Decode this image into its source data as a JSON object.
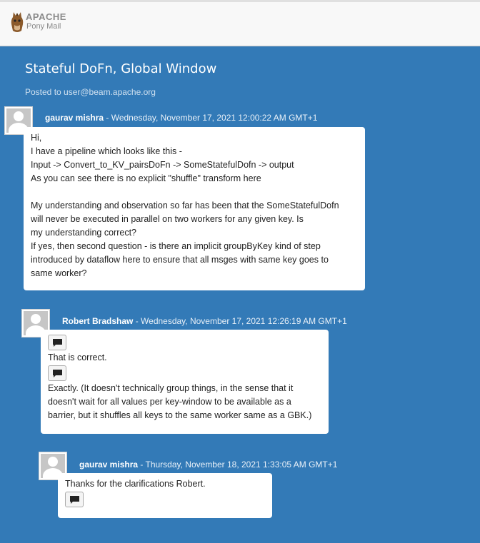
{
  "header": {
    "logo_line1": "APACHE",
    "logo_line2": "Pony Mail"
  },
  "thread": {
    "title": "Stateful DoFn, Global Window",
    "posted_to": "Posted to user@beam.apache.org"
  },
  "messages": [
    {
      "author": "gaurav mishra",
      "date": "Wednesday, November 17, 2021 12:00:22 AM GMT+1",
      "body": "Hi,\nI have a pipeline which looks like this -\nInput -> Convert_to_KV_pairsDoFn -> SomeStatefulDofn -> output\nAs you can see there is no explicit \"shuffle\" transform here\n\nMy understanding and observation so far has been that the SomeStatefulDofn\nwill never be executed in parallel on two workers for any given key. Is\nmy understanding correct?\nIf yes, then second question - is there an implicit groupByKey kind of step\nintroduced by dataflow here to ensure that all msges with same key goes to\nsame worker?"
    },
    {
      "author": "Robert Bradshaw",
      "date": "Wednesday, November 17, 2021 12:26:19 AM GMT+1",
      "line1": "That is correct.",
      "line2": "Exactly. (It doesn't technically group things, in the sense that it\ndoesn't wait for all values per key-window to be available as a\nbarrier, but it shuffles all keys to the same worker same as a GBK.)"
    },
    {
      "author": "gaurav mishra",
      "date": "Thursday, November 18, 2021 1:33:05 AM GMT+1",
      "body": "Thanks for the clarifications Robert."
    }
  ],
  "icons": {
    "quote_toggle": "comment-icon",
    "avatar": "user-avatar-icon"
  },
  "colors": {
    "background": "#337ab7",
    "card": "#ffffff",
    "topbar": "#f8f8f8"
  }
}
